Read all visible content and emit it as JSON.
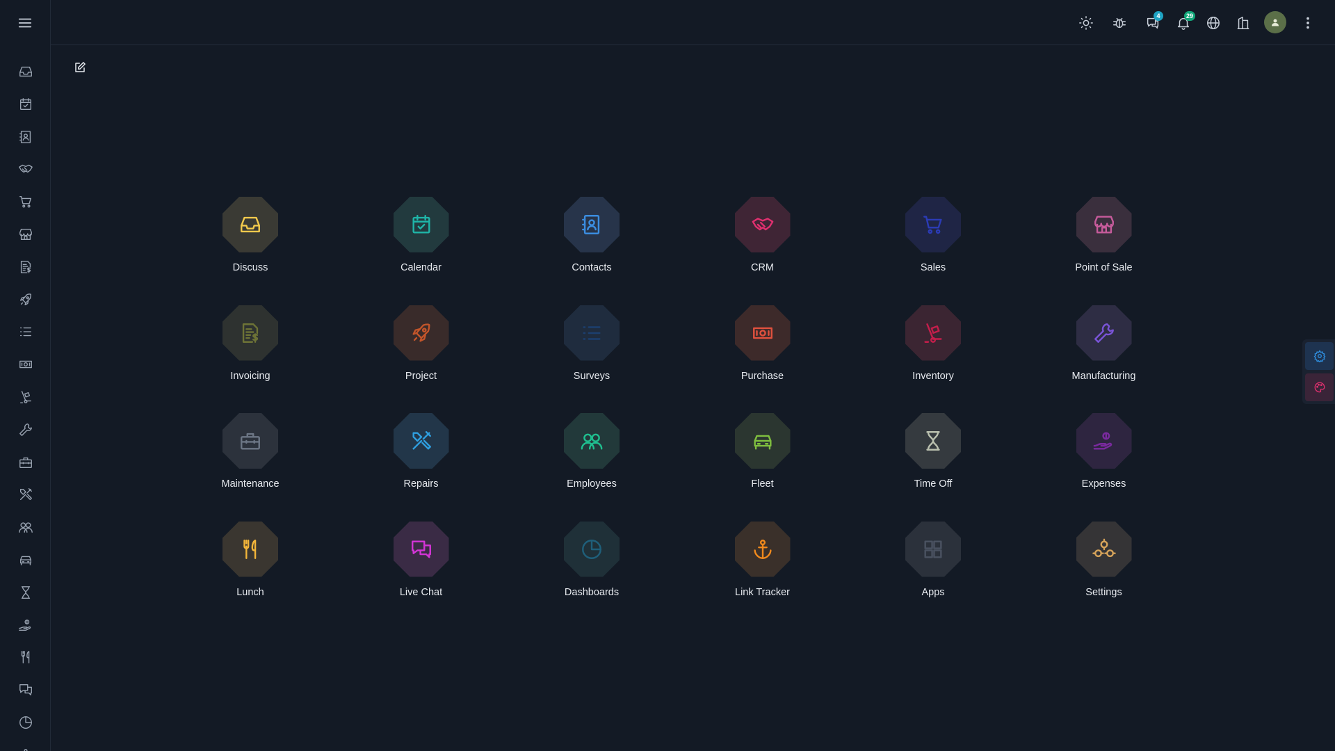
{
  "colors": {
    "background": "#131a25",
    "sidebar_icon": "#9aa4b2",
    "topbar_icon": "#c9d0da",
    "badge_chat": "#1fa4c4",
    "badge_notif": "#12a87a",
    "avatar": "#5b6f48"
  },
  "topbar": {
    "icons": [
      "sun-icon",
      "bug-icon",
      "chat-icon",
      "bell-icon",
      "globe-icon",
      "building-icon",
      "avatar",
      "kebab-menu-icon"
    ],
    "chat_badge": "4",
    "notifications_badge": "29"
  },
  "sidebar": {
    "items": [
      "inbox-icon",
      "calendar-icon",
      "contacts-icon",
      "handshake-icon",
      "cart-icon",
      "store-icon",
      "invoice-icon",
      "rocket-icon",
      "list-icon",
      "money-icon",
      "dolly-icon",
      "wrench-icon",
      "toolbox-icon",
      "tools-icon",
      "people-icon",
      "car-icon",
      "hourglass-icon",
      "hand-coin-icon",
      "utensils-icon",
      "chat-bubbles-icon",
      "pie-chart-icon",
      "anchor-icon"
    ]
  },
  "apps": [
    {
      "label": "Discuss",
      "icon": "inbox-icon",
      "color": "#f2c94c",
      "bg": "#3a3a34"
    },
    {
      "label": "Calendar",
      "icon": "calendar-icon",
      "color": "#1fb5a8",
      "bg": "#223a3e"
    },
    {
      "label": "Contacts",
      "icon": "contacts-icon",
      "color": "#3b8de0",
      "bg": "#27344a"
    },
    {
      "label": "CRM",
      "icon": "handshake-icon",
      "color": "#e0306f",
      "bg": "#3f2535"
    },
    {
      "label": "Sales",
      "icon": "cart-icon",
      "color": "#2b3bb5",
      "bg": "#1f2545"
    },
    {
      "label": "Point of Sale",
      "icon": "store-icon",
      "color": "#c65b9b",
      "bg": "#3a2f3d"
    },
    {
      "label": "Invoicing",
      "icon": "invoice-icon",
      "color": "#6d7336",
      "bg": "#2e3230"
    },
    {
      "label": "Project",
      "icon": "rocket-icon",
      "color": "#c2552a",
      "bg": "#392b2a"
    },
    {
      "label": "Surveys",
      "icon": "list-icon",
      "color": "#1c3f6e",
      "bg": "#1f2c3e"
    },
    {
      "label": "Purchase",
      "icon": "money-icon",
      "color": "#e0513e",
      "bg": "#3d2a2a"
    },
    {
      "label": "Inventory",
      "icon": "dolly-icon",
      "color": "#c41e4b",
      "bg": "#3b2532"
    },
    {
      "label": "Manufacturing",
      "icon": "wrench-icon",
      "color": "#7a54d8",
      "bg": "#2e2d44"
    },
    {
      "label": "Maintenance",
      "icon": "toolbox-icon",
      "color": "#6c7685",
      "bg": "#2c323c"
    },
    {
      "label": "Repairs",
      "icon": "tools-icon",
      "color": "#2f9fe0",
      "bg": "#223649"
    },
    {
      "label": "Employees",
      "icon": "people-icon",
      "color": "#1fbf8f",
      "bg": "#22393a"
    },
    {
      "label": "Fleet",
      "icon": "car-icon",
      "color": "#7fbf3f",
      "bg": "#2b3630"
    },
    {
      "label": "Time Off",
      "icon": "hourglass-icon",
      "color": "#b9bfae",
      "bg": "#353a3f"
    },
    {
      "label": "Expenses",
      "icon": "hand-coin-icon",
      "color": "#7a2a9e",
      "bg": "#2e2540"
    },
    {
      "label": "Lunch",
      "icon": "utensils-icon",
      "color": "#f2b53a",
      "bg": "#3a3630"
    },
    {
      "label": "Live Chat",
      "icon": "chat-bubbles-icon",
      "color": "#d335d6",
      "bg": "#3a2b45"
    },
    {
      "label": "Dashboards",
      "icon": "pie-chart-icon",
      "color": "#1f5f7a",
      "bg": "#1f3038"
    },
    {
      "label": "Link Tracker",
      "icon": "anchor-icon",
      "color": "#f28a1c",
      "bg": "#3a302a"
    },
    {
      "label": "Apps",
      "icon": "grid-icon",
      "color": "#4a5261",
      "bg": "#2b313b"
    },
    {
      "label": "Settings",
      "icon": "cogs-icon",
      "color": "#d6a35a",
      "bg": "#353436"
    }
  ]
}
